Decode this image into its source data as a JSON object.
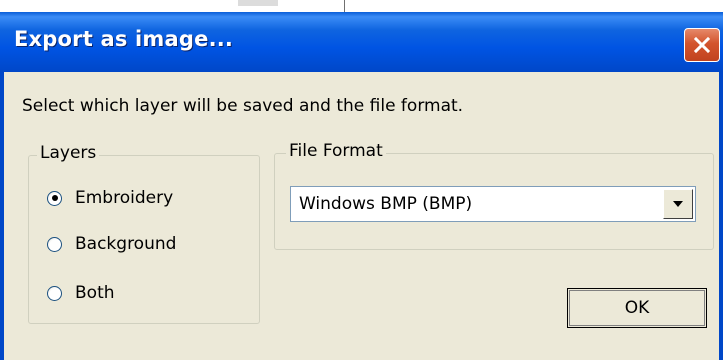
{
  "window": {
    "title": "Export as image..."
  },
  "instruction": "Select which layer will be saved and the file format.",
  "layers": {
    "label": "Layers",
    "options": [
      {
        "label": "Embroidery",
        "selected": true
      },
      {
        "label": "Background",
        "selected": false
      },
      {
        "label": "Both",
        "selected": false
      }
    ]
  },
  "file_format": {
    "label": "File Format",
    "selected": "Windows BMP (BMP)"
  },
  "buttons": {
    "ok": "OK"
  },
  "colors": {
    "titlebar": "#0054e3",
    "dialog_bg": "#ece9d8",
    "close_button": "#d3542d"
  },
  "icons": {
    "close": "close-icon",
    "dropdown": "chevron-down-icon"
  }
}
